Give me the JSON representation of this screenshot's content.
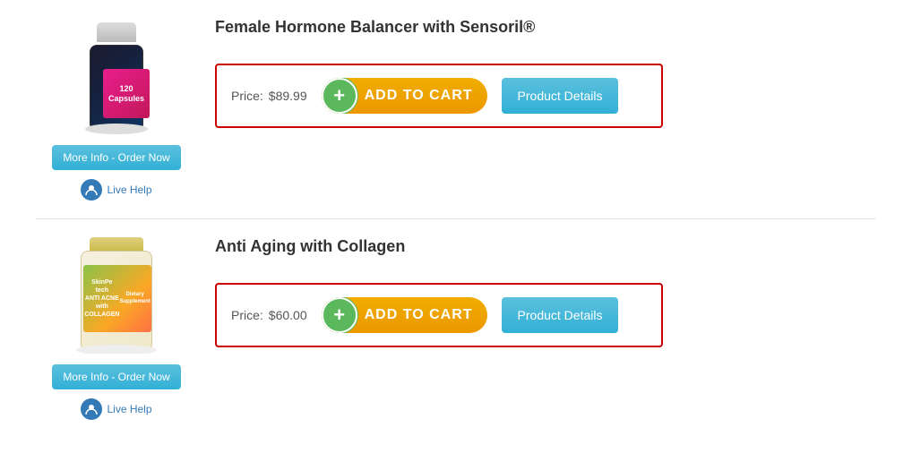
{
  "products": [
    {
      "id": "product-1",
      "title": "Female Hormone Balancer with Sensoril®",
      "price_label": "Price:",
      "price": "$89.99",
      "add_to_cart_label": "ADD TO CART",
      "product_details_label": "Product Details",
      "more_info_label": "More Info - Order Now",
      "live_help_label": "Live Help",
      "bottle_label": "120\nCapsules",
      "type": "bottle1"
    },
    {
      "id": "product-2",
      "title": "Anti Aging with Collagen",
      "price_label": "Price:",
      "price": "$60.00",
      "add_to_cart_label": "ADD TO CART",
      "product_details_label": "Product Details",
      "more_info_label": "More Info - Order Now",
      "live_help_label": "Live Help",
      "bottle_label": "SkinPeätech\nANTI ACNE\nwith COLLAGEN",
      "type": "bottle2"
    }
  ],
  "icons": {
    "plus": "+",
    "person": "&#9654;"
  }
}
